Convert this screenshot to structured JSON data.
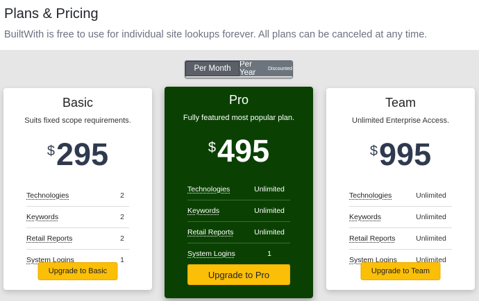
{
  "header": {
    "title": "Plans & Pricing",
    "subtitle": "BuiltWith is free to use for individual site lookups forever. All plans can be canceled at any time."
  },
  "toggle": {
    "month_label": "Per Month",
    "year_label": "Per Year",
    "year_badge": "Discounted",
    "selected": "Per Month"
  },
  "plans": [
    {
      "name": "Basic",
      "description": "Suits fixed scope requirements.",
      "currency": "$",
      "price": "295",
      "features": [
        {
          "name": "Technologies",
          "value": "2"
        },
        {
          "name": "Keywords",
          "value": "2"
        },
        {
          "name": "Retail Reports",
          "value": "2"
        },
        {
          "name": "System Logins",
          "value": "1"
        }
      ],
      "button": "Upgrade to Basic"
    },
    {
      "name": "Pro",
      "description": "Fully featured most popular plan.",
      "currency": "$",
      "price": "495",
      "features": [
        {
          "name": "Technologies",
          "value": "Unlimited"
        },
        {
          "name": "Keywords",
          "value": "Unlimited"
        },
        {
          "name": "Retail Reports",
          "value": "Unlimited"
        },
        {
          "name": "System Logins",
          "value": "1"
        }
      ],
      "button": "Upgrade to Pro"
    },
    {
      "name": "Team",
      "description": "Unlimited Enterprise Access.",
      "currency": "$",
      "price": "995",
      "features": [
        {
          "name": "Technologies",
          "value": "Unlimited"
        },
        {
          "name": "Keywords",
          "value": "Unlimited"
        },
        {
          "name": "Retail Reports",
          "value": "Unlimited"
        },
        {
          "name": "System Logins",
          "value": "Unlimited"
        }
      ],
      "button": "Upgrade to Team"
    }
  ],
  "colors": {
    "pro_card_bg": "#0a4102",
    "button_bg": "#fbbf08",
    "toggle_active": "#5b6068",
    "toggle_inactive": "#6c757d",
    "section_bg": "#e6e6e6"
  }
}
